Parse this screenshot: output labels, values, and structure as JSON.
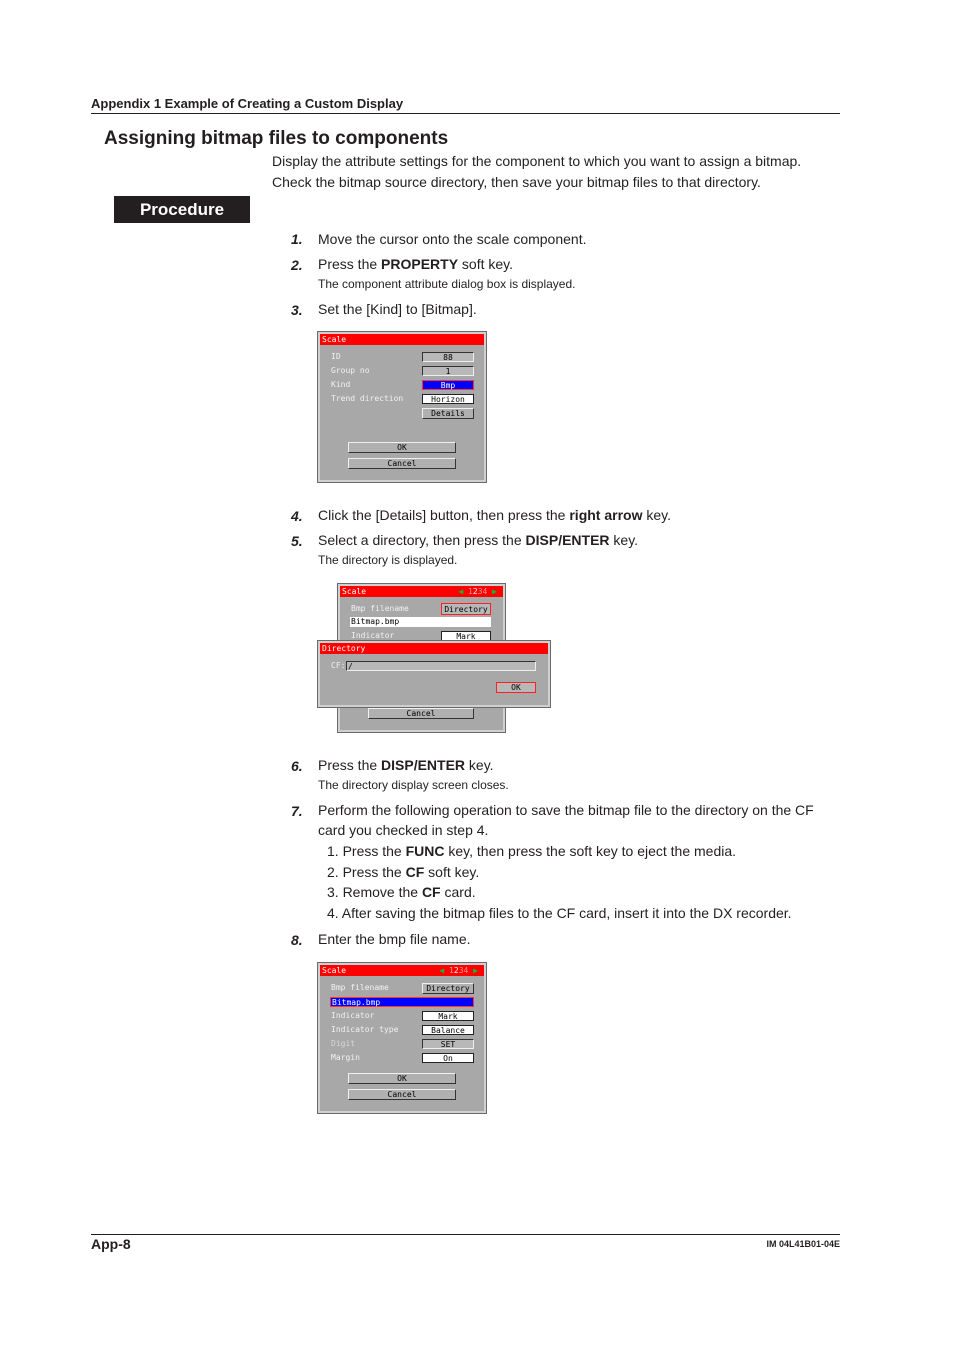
{
  "header": {
    "running_title": "Appendix 1  Example of Creating a Custom Display"
  },
  "section": {
    "title": "Assigning bitmap files to components",
    "intro": [
      "Display the attribute settings for the component to which you want to assign a bitmap.",
      "Check the bitmap source directory, then save your bitmap files to that directory."
    ],
    "procedure_label": "Procedure"
  },
  "steps": [
    {
      "num": "1.",
      "text": "Move the cursor onto the scale component."
    },
    {
      "num": "2.",
      "pre": "Press the ",
      "bold": "PROPERTY",
      "post": " soft key.",
      "note": "The component attribute dialog box is displayed."
    },
    {
      "num": "3.",
      "text": "Set the [Kind] to [Bitmap]."
    },
    {
      "num": "4.",
      "pre": "Click the [Details] button, then press the ",
      "bold": "right arrow",
      "post": " key."
    },
    {
      "num": "5.",
      "pre": "Select a directory, then press the ",
      "bold": "DISP/ENTER",
      "post": " key.",
      "note": "The directory is displayed."
    },
    {
      "num": "6.",
      "pre": "Press the ",
      "bold": "DISP/ENTER",
      "post": " key.",
      "note": "The directory display screen closes."
    },
    {
      "num": "7.",
      "text_line1": "Perform the following operation to save the bitmap file to the directory on the CF",
      "text_line2": "card you checked in step 4.",
      "substeps": [
        {
          "pre": "1.  Press the ",
          "bold": "FUNC",
          "post": " key, then press the soft key to eject the media."
        },
        {
          "pre": "2.  Press the ",
          "bold": "CF",
          "post": " soft key."
        },
        {
          "pre": "3.  Remove the ",
          "bold": "CF",
          "post": " card."
        },
        {
          "pre": "4.  After saving the bitmap files to the CF card, insert it into the DX recorder.",
          "bold": "",
          "post": ""
        }
      ]
    },
    {
      "num": "8.",
      "text": "Enter the bmp file name."
    }
  ],
  "dialog1": {
    "title": "Scale",
    "rows": [
      {
        "label": "ID",
        "value": "88"
      },
      {
        "label": "Group no",
        "value": "1"
      },
      {
        "label": "Kind",
        "value": "Bmp"
      },
      {
        "label": "Trend direction",
        "value": "Horizon"
      }
    ],
    "details": "Details",
    "ok": "OK",
    "cancel": "Cancel"
  },
  "dialog2": {
    "title": "Scale",
    "pages": {
      "left_arrow": "◀",
      "p1": "1",
      "p2": "2",
      "p3": "3",
      "p4": "4",
      "right_arrow": "▶"
    },
    "bmp_label": "Bmp filename",
    "directory_btn": "Directory",
    "filename": "Bitmap.bmp",
    "indicator_label": "Indicator",
    "indicator_value": "Mark",
    "cancel": "Cancel",
    "popup": {
      "title": "Directory",
      "cf_label": "CF:",
      "path": "/",
      "ok": "OK"
    }
  },
  "dialog3": {
    "title": "Scale",
    "pages": {
      "left_arrow": "◀",
      "p1": "1",
      "p2": "2",
      "p3": "3",
      "p4": "4",
      "right_arrow": "▶"
    },
    "bmp_label": "Bmp filename",
    "directory_btn": "Directory",
    "filename": "Bitmap.bmp",
    "rows": [
      {
        "label": "Indicator",
        "value": "Mark"
      },
      {
        "label": "Indicator type",
        "value": "Balance"
      },
      {
        "label": "Digit",
        "value": "SET"
      },
      {
        "label": "Margin",
        "value": "On"
      }
    ],
    "ok": "OK",
    "cancel": "Cancel"
  },
  "footer": {
    "page": "App-8",
    "doc_id": "IM 04L41B01-04E"
  }
}
